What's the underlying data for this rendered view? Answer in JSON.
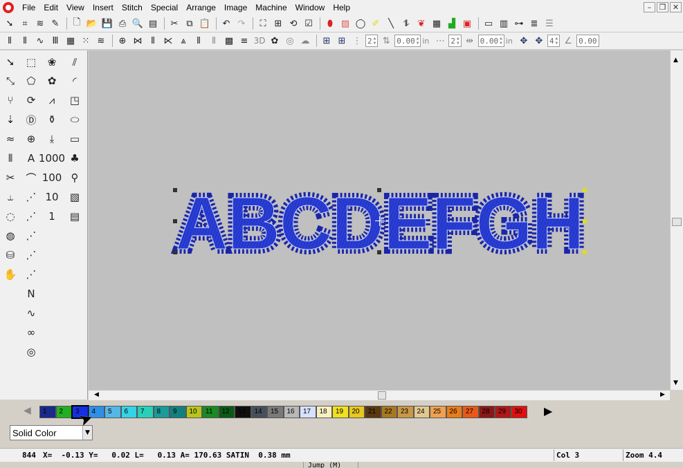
{
  "menu": [
    "File",
    "Edit",
    "View",
    "Insert",
    "Stitch",
    "Special",
    "Arrange",
    "Image",
    "Machine",
    "Window",
    "Help"
  ],
  "window_controls": {
    "minimize": "–",
    "restore": "❐",
    "close": "✕"
  },
  "toolbar2": {
    "label_3d": "3D",
    "spin1_value": "2",
    "spin2_value": "0.00",
    "spin2_unit": "in",
    "spin3_value": "2",
    "spin4_value": "0.00",
    "spin4_unit": "in",
    "spin5_value": "4",
    "spin6_value": "0.00"
  },
  "palette": {
    "text_tool_glyph": "A",
    "num_1000": "1000",
    "num_100": "100",
    "num_10": "10",
    "num_1": "1"
  },
  "design": {
    "text": "ABCDEFGH",
    "fill_color": "#2a3fd6",
    "fill_dark": "#1a26a8",
    "outline_color": "#c8d2ff"
  },
  "colorbar": {
    "swatches": [
      {
        "n": "1",
        "c": "#1a2a8a"
      },
      {
        "n": "2",
        "c": "#22b022"
      },
      {
        "n": "3",
        "c": "#1530e0"
      },
      {
        "n": "4",
        "c": "#2e8fe8"
      },
      {
        "n": "5",
        "c": "#55b6e8"
      },
      {
        "n": "6",
        "c": "#34d4e8"
      },
      {
        "n": "7",
        "c": "#28d0b8"
      },
      {
        "n": "8",
        "c": "#1a9a9a"
      },
      {
        "n": "9",
        "c": "#138080"
      },
      {
        "n": "10",
        "c": "#b8c41a"
      },
      {
        "n": "11",
        "c": "#1a8a22"
      },
      {
        "n": "12",
        "c": "#0a5a16"
      },
      {
        "n": "13",
        "c": "#101010"
      },
      {
        "n": "14",
        "c": "#46505a"
      },
      {
        "n": "15",
        "c": "#7a7a7a"
      },
      {
        "n": "16",
        "c": "#b8b8b8"
      },
      {
        "n": "17",
        "c": "#d8e0ff"
      },
      {
        "n": "18",
        "c": "#f8f0c0"
      },
      {
        "n": "19",
        "c": "#f0e020"
      },
      {
        "n": "20",
        "c": "#e8c820"
      },
      {
        "n": "21",
        "c": "#5a3812"
      },
      {
        "n": "22",
        "c": "#a87820"
      },
      {
        "n": "23",
        "c": "#c89848"
      },
      {
        "n": "24",
        "c": "#e0c890"
      },
      {
        "n": "25",
        "c": "#f0a050"
      },
      {
        "n": "26",
        "c": "#e87c18"
      },
      {
        "n": "27",
        "c": "#e85818"
      },
      {
        "n": "28",
        "c": "#8a1818"
      },
      {
        "n": "29",
        "c": "#b01818"
      },
      {
        "n": "30",
        "c": "#e01010"
      }
    ],
    "selected_index": 2
  },
  "color_mode": {
    "value": "Solid Color"
  },
  "status": {
    "stitch_count": "844",
    "coords": "X=  -0.13 Y=   0.02 L=   0.13 A= 170.63 SATIN  0.38 mm",
    "col": "Col 3",
    "zoom": "Zoom 4.4",
    "tooltip": "Jump (M)"
  }
}
